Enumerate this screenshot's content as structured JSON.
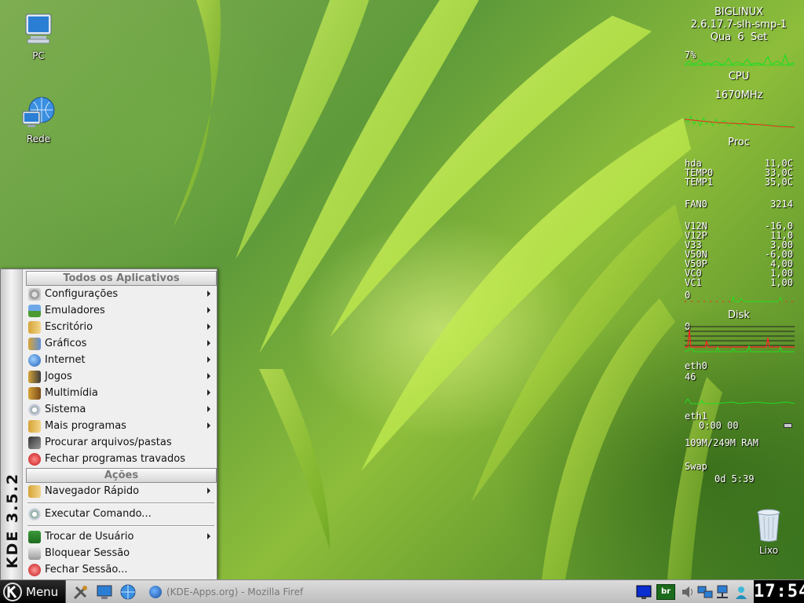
{
  "desktop": {
    "icons": [
      {
        "label": "PC",
        "icon": "computer-icon"
      },
      {
        "label": "Rede",
        "icon": "network-globe-icon"
      },
      {
        "label": "Lixo",
        "icon": "trash-icon"
      }
    ]
  },
  "conky": {
    "host": "BIGLINUX",
    "kernel": "2.6.17.7-slh-smp-1",
    "date_day": "Qua",
    "date_num": "6",
    "date_month": "Set",
    "cpu_percent": "7%",
    "cpu_label": "CPU",
    "cpu_freq": "1670MHz",
    "proc_label": "Proc",
    "sensors": [
      {
        "name": "hda",
        "value": "11,0C"
      },
      {
        "name": "TEMP0",
        "value": "33,0C"
      },
      {
        "name": "TEMP1",
        "value": "35,0C"
      }
    ],
    "fan": {
      "name": "FAN0",
      "value": "3214"
    },
    "voltages": [
      {
        "name": "V12N",
        "value": "-16,0"
      },
      {
        "name": "V12P",
        "value": "11,0"
      },
      {
        "name": "V33",
        "value": "3,00"
      },
      {
        "name": "V50N",
        "value": "-6,00"
      },
      {
        "name": "V50P",
        "value": "4,00"
      },
      {
        "name": "VC0",
        "value": "1,00"
      },
      {
        "name": "VC1",
        "value": "1,00"
      }
    ],
    "volt_graph_value": "0",
    "disk_label": "Disk",
    "disk_value": "0",
    "eth0_label": "eth0",
    "eth0_value": "46",
    "eth1_label": "eth1",
    "eth1_value": "0:00  00",
    "ram": "109M/249M RAM",
    "swap_label": "Swap",
    "uptime": "0d  5:39",
    "colors": {
      "graph_green": "#22dd22",
      "graph_red": "#ff2020"
    }
  },
  "kmenu": {
    "side_text": "KDE 3.5.2",
    "header_apps": "Todos os Aplicativos",
    "apps": [
      {
        "label": "Configurações",
        "icon": "settings-icon",
        "submenu": true
      },
      {
        "label": "Emuladores",
        "icon": "emulators-icon",
        "submenu": true
      },
      {
        "label": "Escritório",
        "icon": "office-icon",
        "submenu": true
      },
      {
        "label": "Gráficos",
        "icon": "graphics-icon",
        "submenu": true
      },
      {
        "label": "Internet",
        "icon": "internet-icon",
        "submenu": true
      },
      {
        "label": "Jogos",
        "icon": "games-icon",
        "submenu": true
      },
      {
        "label": "Multimídia",
        "icon": "multimedia-icon",
        "submenu": true
      },
      {
        "label": "Sistema",
        "icon": "system-icon",
        "submenu": true
      },
      {
        "label": "Mais programas",
        "icon": "more-programs-icon",
        "submenu": true
      },
      {
        "label": "Procurar arquivos/pastas",
        "icon": "find-files-icon",
        "submenu": false
      },
      {
        "label": "Fechar programas travados",
        "icon": "kill-icon",
        "submenu": false
      }
    ],
    "header_actions": "Ações",
    "quick_browser": "Navegador Rápido",
    "run_command": "Executar Comando...",
    "switch_user": "Trocar de Usuário",
    "lock_session": "Bloquear Sessão",
    "logout": "Fechar Sessão..."
  },
  "taskbar": {
    "menu_label": "Menu",
    "window_title": "(KDE-Apps.org) - Mozilla Firef",
    "clock": "17:54",
    "tray_flag_label": "br"
  }
}
